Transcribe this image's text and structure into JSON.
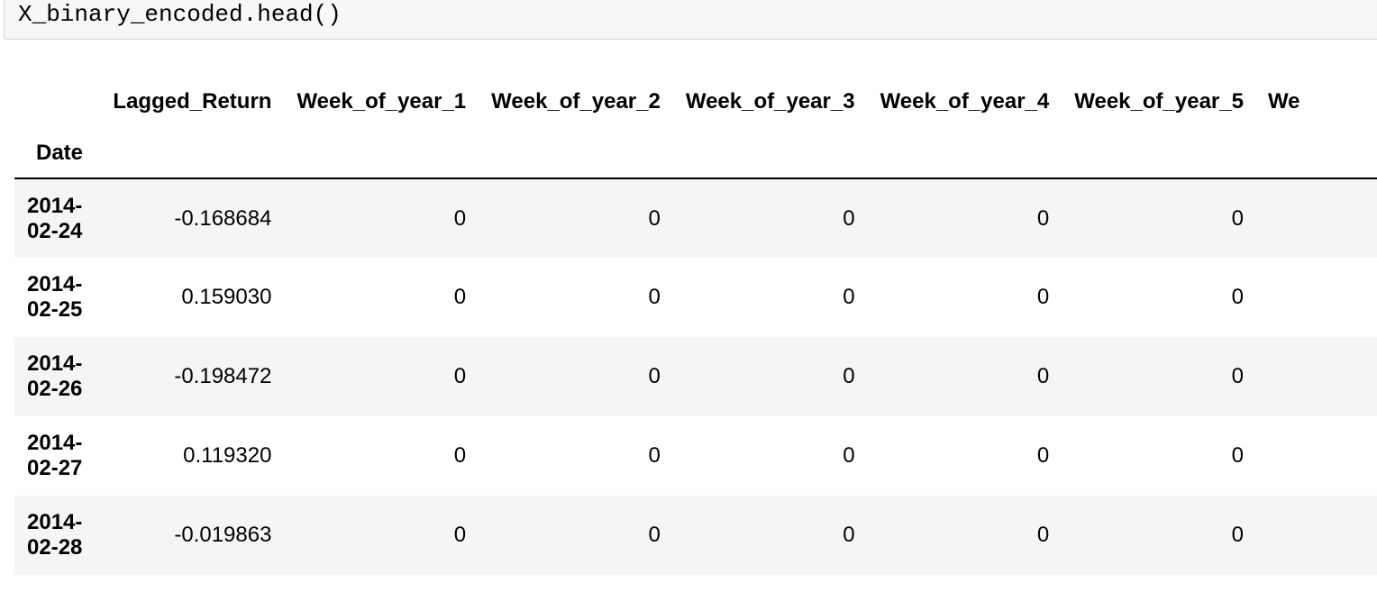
{
  "cell": {
    "code": "X_binary_encoded.head()"
  },
  "dataframe": {
    "index_name": "Date",
    "columns": [
      "Lagged_Return",
      "Week_of_year_1",
      "Week_of_year_2",
      "Week_of_year_3",
      "Week_of_year_4",
      "Week_of_year_5",
      "We"
    ],
    "rows": [
      {
        "date": "2014-02-24",
        "values": [
          "-0.168684",
          "0",
          "0",
          "0",
          "0",
          "0"
        ]
      },
      {
        "date": "2014-02-25",
        "values": [
          "0.159030",
          "0",
          "0",
          "0",
          "0",
          "0"
        ]
      },
      {
        "date": "2014-02-26",
        "values": [
          "-0.198472",
          "0",
          "0",
          "0",
          "0",
          "0"
        ]
      },
      {
        "date": "2014-02-27",
        "values": [
          "0.119320",
          "0",
          "0",
          "0",
          "0",
          "0"
        ]
      },
      {
        "date": "2014-02-28",
        "values": [
          "-0.019863",
          "0",
          "0",
          "0",
          "0",
          "0"
        ]
      }
    ]
  }
}
